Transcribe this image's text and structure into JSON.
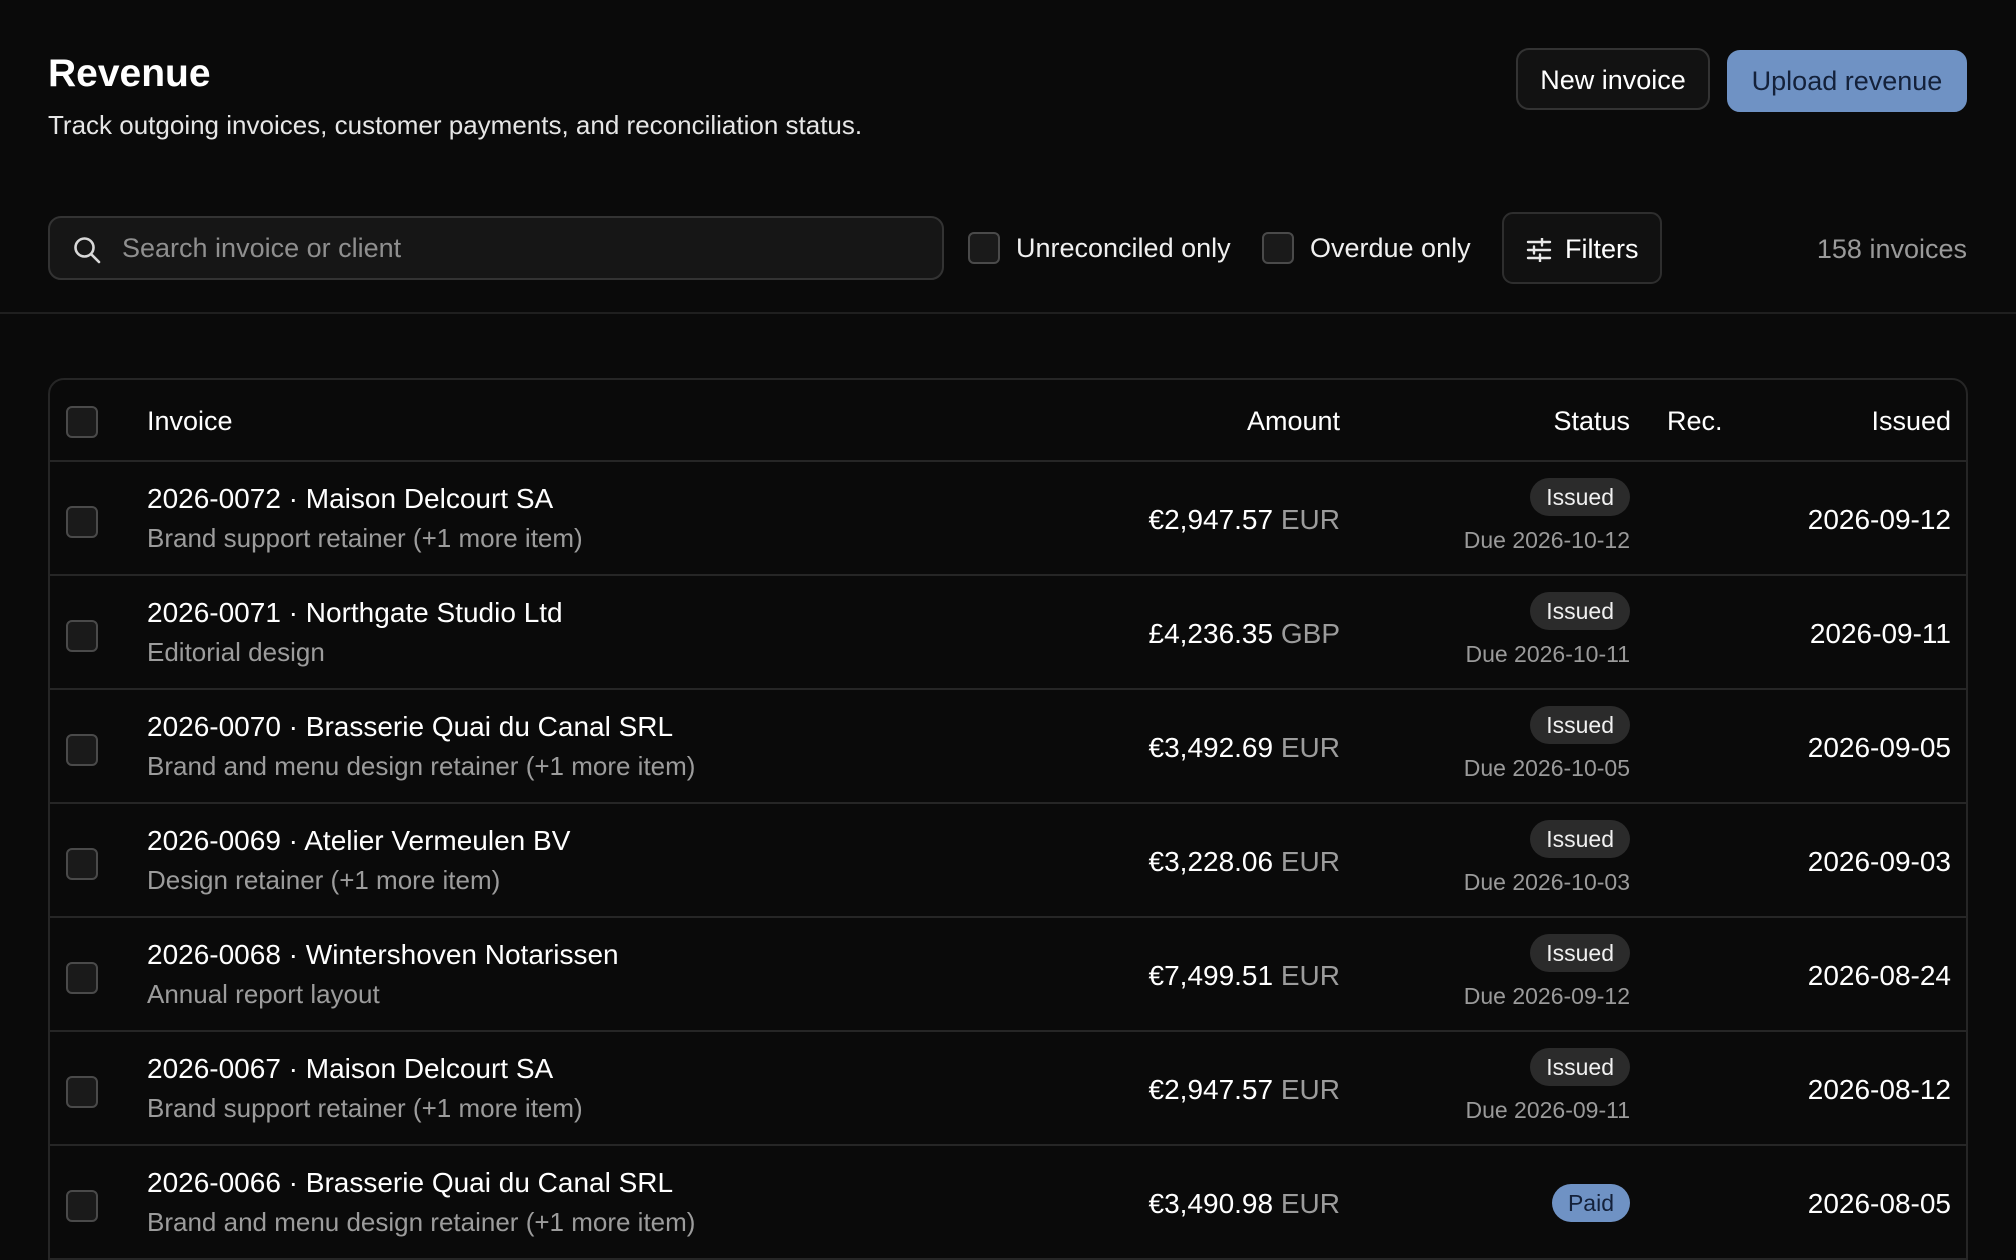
{
  "header": {
    "title": "Revenue",
    "subtitle": "Track outgoing invoices, customer payments, and reconciliation status.",
    "new_invoice_label": "New invoice",
    "upload_label": "Upload revenue"
  },
  "toolbar": {
    "search_placeholder": "Search invoice or client",
    "search_value": "",
    "unreconciled_label": "Unreconciled only",
    "overdue_label": "Overdue only",
    "filters_label": "Filters",
    "count_label": "158 invoices"
  },
  "table": {
    "headers": {
      "invoice": "Invoice",
      "amount": "Amount",
      "status": "Status",
      "rec": "Rec.",
      "issued": "Issued"
    },
    "rows": [
      {
        "title": "2026-0072 · Maison Delcourt SA",
        "desc": "Brand support retainer (+1 more item)",
        "amount": "€2,947.57",
        "currency": "EUR",
        "status": "Issued",
        "due": "Due 2026-10-12",
        "issued": "2026-09-12"
      },
      {
        "title": "2026-0071 · Northgate Studio Ltd",
        "desc": "Editorial design",
        "amount": "£4,236.35",
        "currency": "GBP",
        "status": "Issued",
        "due": "Due 2026-10-11",
        "issued": "2026-09-11"
      },
      {
        "title": "2026-0070 · Brasserie Quai du Canal SRL",
        "desc": "Brand and menu design retainer (+1 more item)",
        "amount": "€3,492.69",
        "currency": "EUR",
        "status": "Issued",
        "due": "Due 2026-10-05",
        "issued": "2026-09-05"
      },
      {
        "title": "2026-0069 · Atelier Vermeulen BV",
        "desc": "Design retainer (+1 more item)",
        "amount": "€3,228.06",
        "currency": "EUR",
        "status": "Issued",
        "due": "Due 2026-10-03",
        "issued": "2026-09-03"
      },
      {
        "title": "2026-0068 · Wintershoven Notarissen",
        "desc": "Annual report layout",
        "amount": "€7,499.51",
        "currency": "EUR",
        "status": "Issued",
        "due": "Due 2026-09-12",
        "issued": "2026-08-24"
      },
      {
        "title": "2026-0067 · Maison Delcourt SA",
        "desc": "Brand support retainer (+1 more item)",
        "amount": "€2,947.57",
        "currency": "EUR",
        "status": "Issued",
        "due": "Due 2026-09-11",
        "issued": "2026-08-12"
      },
      {
        "title": "2026-0066 · Brasserie Quai du Canal SRL",
        "desc": "Brand and menu design retainer (+1 more item)",
        "amount": "€3,490.98",
        "currency": "EUR",
        "status": "Paid",
        "due": "",
        "issued": "2026-08-05"
      }
    ]
  },
  "icons": {
    "search": "search-icon",
    "filters": "sliders-icon"
  },
  "colors": {
    "background": "#0a0a0a",
    "accent": "#6f92c4",
    "muted_text": "#9c9c9c",
    "border": "#262626"
  }
}
